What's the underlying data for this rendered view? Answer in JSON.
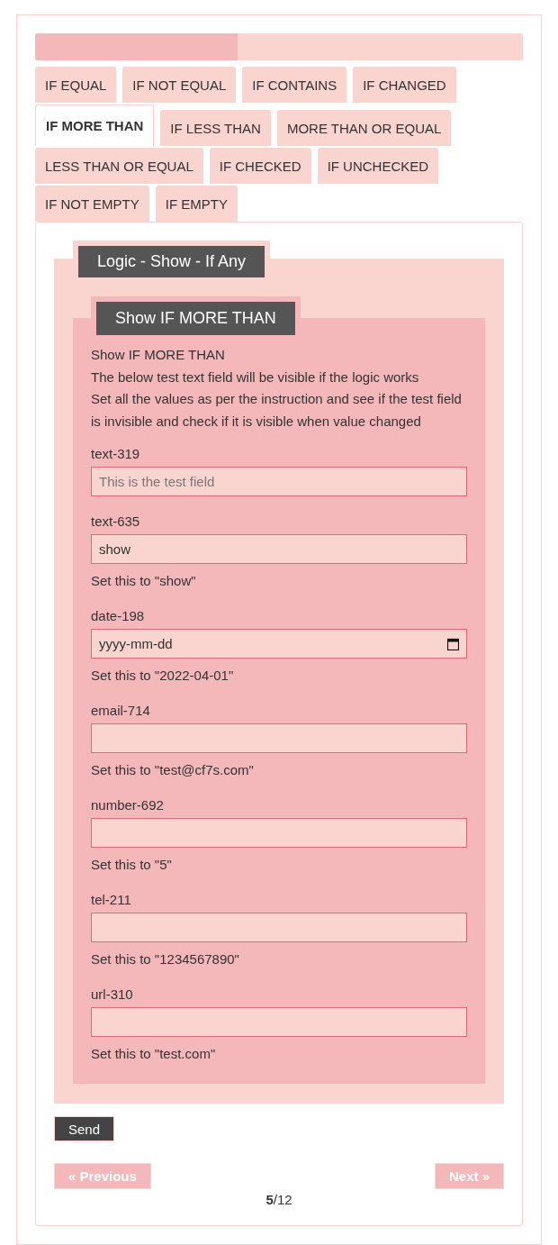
{
  "progress": {
    "level": 0.415
  },
  "tabs": [
    {
      "label": "IF EQUAL",
      "selected": false
    },
    {
      "label": "IF NOT EQUAL",
      "selected": false
    },
    {
      "label": "IF CONTAINS",
      "selected": false
    },
    {
      "label": "IF CHANGED",
      "selected": false
    },
    {
      "label": "IF MORE THAN",
      "selected": true
    },
    {
      "label": "IF LESS THAN",
      "selected": false
    },
    {
      "label": "MORE THAN OR EQUAL",
      "selected": false
    },
    {
      "label": "LESS THAN OR EQUAL",
      "selected": false
    },
    {
      "label": "IF CHECKED",
      "selected": false
    },
    {
      "label": "IF UNCHECKED",
      "selected": false
    },
    {
      "label": "IF NOT EMPTY",
      "selected": false
    },
    {
      "label": "IF EMPTY",
      "selected": false
    }
  ],
  "group": {
    "legend": "Logic - Show - If Any",
    "section": {
      "legend": "Show IF MORE THAN",
      "description": [
        "Show IF MORE THAN",
        "The below test text field will be visible if the logic works",
        "Set all the values as per the instruction and see if the test field is invisible and check if it is visible when value changed"
      ],
      "fields": [
        {
          "label": "text-319",
          "kind": "text",
          "placeholder": "This is the test field"
        },
        {
          "label": "text-635",
          "kind": "text",
          "value": "show",
          "hint": "Set this to \"show\""
        },
        {
          "label": "date-198",
          "kind": "date",
          "placeholder": "yyyy-mm-dd",
          "hint": "Set this to \"2022-04-01\""
        },
        {
          "label": "email-714",
          "kind": "text",
          "hint": "Set this to \"test@cf7s.com\""
        },
        {
          "label": "number-692",
          "kind": "text",
          "hint": "Set this to \"5\""
        },
        {
          "label": "tel-211",
          "kind": "text",
          "hint": "Set this to \"1234567890\""
        },
        {
          "label": "url-310",
          "kind": "text",
          "hint": "Set this to \"test.com\""
        }
      ]
    }
  },
  "send": "Send",
  "previous": "« Previous",
  "next": "Next »",
  "page": "**5**/12"
}
